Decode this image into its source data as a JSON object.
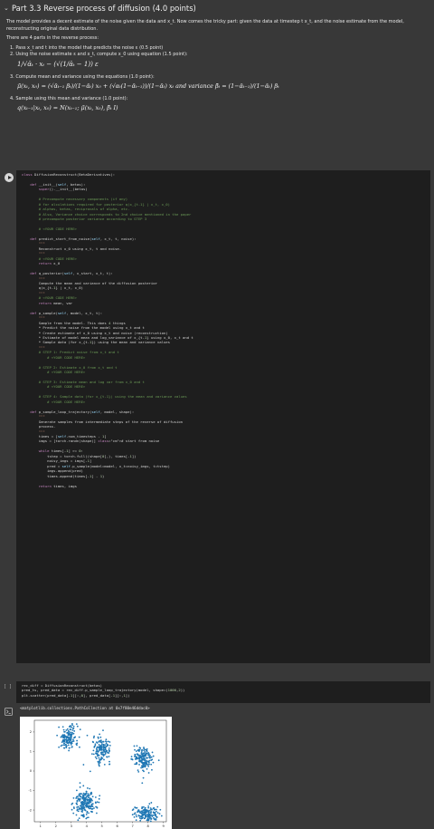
{
  "section": {
    "title": "Part 3.3 Reverse process of diffusion (4.0 points)"
  },
  "intro": {
    "p1": "The model provides a decent estimate of the noise given the data and x_t. Now comes the tricky part: given the data at timestep t x_t, and the noise estimate from the model, reconstructing original data distribution.",
    "p2": "There are 4 parts in the reverse process:",
    "step1": "1. Pass x_t and t into the model that predicts the noise ε (0.5 point)",
    "step2": "2. Using the noise estimate ε and x_t, compute x_0 using equation (1.5 point):",
    "eq1": "1/√ᾱₜ · xₜ − (√(1/ᾱₜ − 1)) ε",
    "step3": "3. Compute mean and variance using the equations (1.0 point):",
    "eq2": "μ̃(xₜ, x₀) = (√ᾱₜ₋₁ βₜ)/(1−ᾱₜ) x₀ + (√αₜ(1−ᾱₜ₋₁))/(1−ᾱₜ) xₜ  and variance  β̃ₜ = (1−ᾱₜ₋₁)/(1−ᾱₜ) βₜ",
    "step4": "4. Sample using this mean and variance (1.0 point):",
    "eq3": "q(xₜ₋₁|xₜ, x₀) = N(xₜ₋₁; μ̃(xₜ, x₀), β̃ₜ I)"
  },
  "code_lines": [
    "class DiffusionReconstruct(BetaDerivatives):",
    "",
    "    def __init__(self, betas):",
    "        super().__init__(betas)",
    "",
    "        # Precompute necessary components (if any)",
    "        # for alculations required for posterior q(x_{t-1} | x_t, x_0)",
    "        # alphas, betas, reciprocals of alpha, etc.",
    "        # Also, Variance choice corresponds to 2nd choice mentioned in the paper",
    "        # precompute posterior variance according to STEP 3",
    "",
    "        # <YOUR CODE HERE>",
    "",
    "    def predict_start_from_noise(self, x_t, t, noise):",
    "        \"\"\"",
    "        Reconstruct x_0 using x_t, t and noise.",
    "        \"\"\"",
    "        # <YOUR CODE HERE>",
    "        return x_0",
    "",
    "    def q_posterior(self, x_start, x_t, t):",
    "        \"\"\"",
    "        Compute the mean and variance of the diffusion posterior",
    "        q(x_{t-1} | x_t, x_0)",
    "        \"\"\"",
    "        # <YOUR CODE HERE>",
    "        return mean, var",
    "",
    "    def p_sample(self, model, x_t, t):",
    "        \"\"\"",
    "        Sample from the model. This does 4 things",
    "        * Predict the noise from the model using x_t and t",
    "        * Create estimate of x_0 using x_t and noise (reconstruction)",
    "        * Estimate of model mean and log_variance of x_{t-1} using x_0, x_t and t",
    "        * Sample data (for x_{t-1}) using the mean and variance values",
    "        \"\"\"",
    "        # STEP 1: Predict noise from x_t and t",
    "            # <YOUR CODE HERE>",
    "",
    "        # STEP 2: Estimate x_0 from x_t and t",
    "            # <YOUR CODE HERE>",
    "",
    "        # STEP 3: Estimate mean and log var from x_0 and t",
    "            # <YOUR CODE HERE>",
    "",
    "        # STEP 4: Sample data (for x_{t-1}) using the mean and variance values",
    "            # <YOUR CODE HERE>",
    "",
    "    def p_sample_loop_trajectory(self, model, shape):",
    "        \"\"\"",
    "        Generate samples from intermediate steps of the reverse of diffusion",
    "        process.",
    "        \"\"\"",
    "        times = [self.num_timesteps - 1]",
    "        imgs = [torch.randn(shape)] # start from noise",
    "",
    "        while times[-1] >= 0:",
    "            tstep = torch.full((shape[0],), times[-1])",
    "            noisy_imgs = imgs[-1]",
    "            pred = self.p_sample(model=model, x_t=noisy_imgs, t=tstep)",
    "            imgs.append(pred)",
    "            times.append(times[-1] - 1)",
    "",
    "        return times, imgs"
  ],
  "run_code_lines": [
    "rec_diff = DiffusionReconstruct(betas)",
    "pred_ts, pred_data = rec_diff.p_sample_loop_trajectory(model, shape=(1000,2))",
    "plt.scatter(pred_data[-1][:,0], pred_data[-1][:,1])"
  ],
  "run_prompt": "[ ]",
  "output_text": "<matplotlib.collections.PathCollection at 0x7f80e46ddac0>",
  "colors": {
    "point": "#1f77b4",
    "code_bg": "#1e1e1e",
    "page_bg": "#383838"
  },
  "chart_data": {
    "type": "scatter",
    "title": "",
    "xlabel": "",
    "ylabel": "",
    "xlim": [
      0.6,
      9.2
    ],
    "ylim": [
      -2.6,
      2.6
    ],
    "xticks": [
      "1",
      "2",
      "3",
      "4",
      "5",
      "6",
      "7",
      "8",
      "9"
    ],
    "yticks": [
      "2",
      "1",
      "0",
      "-1",
      "-2"
    ],
    "xtick_values": [
      1,
      2,
      3,
      4,
      5,
      6,
      7,
      8,
      9
    ],
    "ytick_values": [
      2,
      1,
      0,
      -1,
      -2
    ],
    "clusters": [
      {
        "cx": 2.8,
        "cy": 1.7,
        "sx": 0.32,
        "sy": 0.32,
        "n": 160
      },
      {
        "cx": 5.0,
        "cy": 1.1,
        "sx": 0.28,
        "sy": 0.32,
        "n": 160
      },
      {
        "cx": 7.7,
        "cy": 0.6,
        "sx": 0.32,
        "sy": 0.3,
        "n": 180
      },
      {
        "cx": 3.9,
        "cy": -1.6,
        "sx": 0.35,
        "sy": 0.35,
        "n": 220
      },
      {
        "cx": 7.9,
        "cy": -2.2,
        "sx": 0.4,
        "sy": 0.2,
        "n": 160
      }
    ]
  }
}
